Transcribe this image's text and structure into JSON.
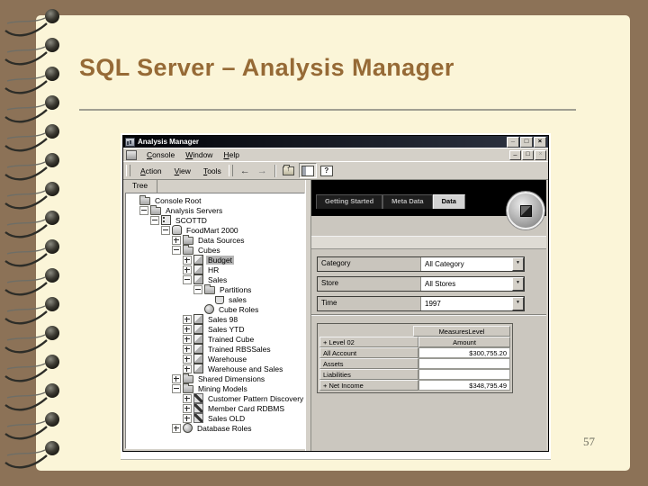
{
  "slide": {
    "title": "SQL Server – Analysis Manager",
    "page_number": "57"
  },
  "window": {
    "title": "Analysis Manager",
    "controls": {
      "minimize": "_",
      "maximize": "□",
      "close": "×"
    },
    "mdi_controls": {
      "minimize": "_",
      "restore": "□",
      "close": "×"
    },
    "menus": [
      {
        "label": "Console"
      },
      {
        "label": "Window"
      },
      {
        "label": "Help"
      }
    ],
    "toolbar": {
      "menus": [
        {
          "label": "Action"
        },
        {
          "label": "View"
        },
        {
          "label": "Tools"
        }
      ],
      "back": "←",
      "forward": "→",
      "help_glyph": "?"
    },
    "tree_tab": "Tree"
  },
  "tree": {
    "items": [
      {
        "label": "Console Root"
      },
      {
        "label": "Analysis Servers"
      },
      {
        "label": "SCOTTD"
      },
      {
        "label": "FoodMart 2000"
      },
      {
        "label": "Data Sources"
      },
      {
        "label": "Cubes"
      },
      {
        "label": "Budget"
      },
      {
        "label": "HR"
      },
      {
        "label": "Sales"
      },
      {
        "label": "Partitions"
      },
      {
        "label": "sales"
      },
      {
        "label": "Cube Roles"
      },
      {
        "label": "Sales 98"
      },
      {
        "label": "Sales YTD"
      },
      {
        "label": "Trained Cube"
      },
      {
        "label": "Trained RBSSales"
      },
      {
        "label": "Warehouse"
      },
      {
        "label": "Warehouse and Sales"
      },
      {
        "label": "Shared Dimensions"
      },
      {
        "label": "Mining Models"
      },
      {
        "label": "Customer Pattern Discovery"
      },
      {
        "label": "Member Card RDBMS"
      },
      {
        "label": "Sales OLD"
      },
      {
        "label": "Database Roles"
      }
    ]
  },
  "data_panel": {
    "tabs": [
      {
        "label": "Getting Started"
      },
      {
        "label": "Meta Data"
      },
      {
        "label": "Data"
      }
    ],
    "active_tab": "Data",
    "filters": [
      {
        "label": "Category",
        "value": "All Category"
      },
      {
        "label": "Store",
        "value": "All Stores"
      },
      {
        "label": "Time",
        "value": "1997"
      }
    ],
    "grid": {
      "measures_header": "MeasuresLevel",
      "level_header": "+ Level 02",
      "measure_column": "Amount",
      "rows": [
        {
          "label": "All Account",
          "value": "$300,755.20"
        },
        {
          "label": "Assets",
          "value": ""
        },
        {
          "label": "Liabilities",
          "value": ""
        },
        {
          "label": "+ Net Income",
          "value": "$348,795.49"
        }
      ]
    }
  },
  "colors": {
    "backdrop": "#8c7257",
    "page": "#fbf5d8",
    "title_text": "#966a36",
    "ui_gray": "#d4d0c8",
    "selection": "#b5b5b5",
    "banner": "#000000"
  }
}
